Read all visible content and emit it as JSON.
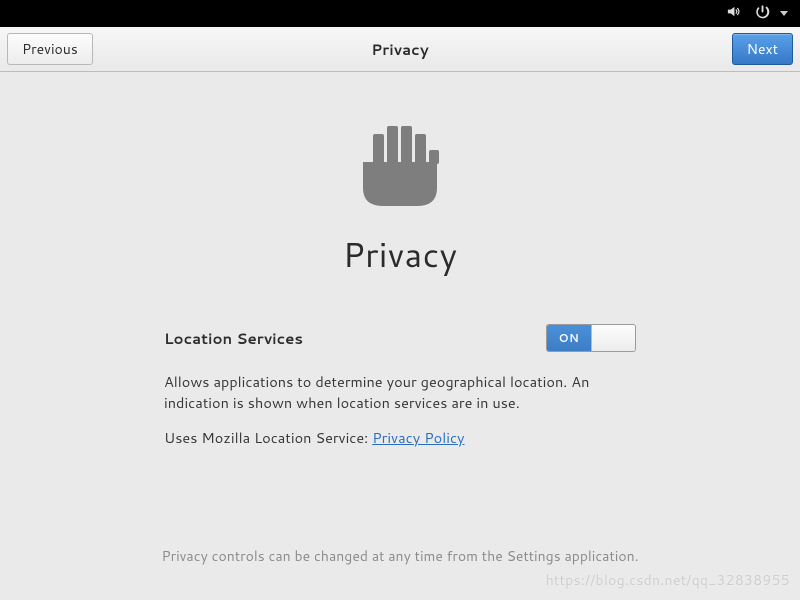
{
  "sysbar": {},
  "header": {
    "title": "Privacy",
    "previous_label": "Previous",
    "next_label": "Next"
  },
  "page": {
    "heading": "Privacy",
    "location_label": "Location Services",
    "switch_on_label": "ON",
    "description": "Allows applications to determine your geographical location. An indication is shown when location services are in use.",
    "uses_prefix": "Uses Mozilla Location Service: ",
    "privacy_link_label": "Privacy Policy",
    "footer_note": "Privacy controls can be changed at any time from the Settings application.",
    "watermark": "https://blog.csdn.net/qq_32838955"
  }
}
